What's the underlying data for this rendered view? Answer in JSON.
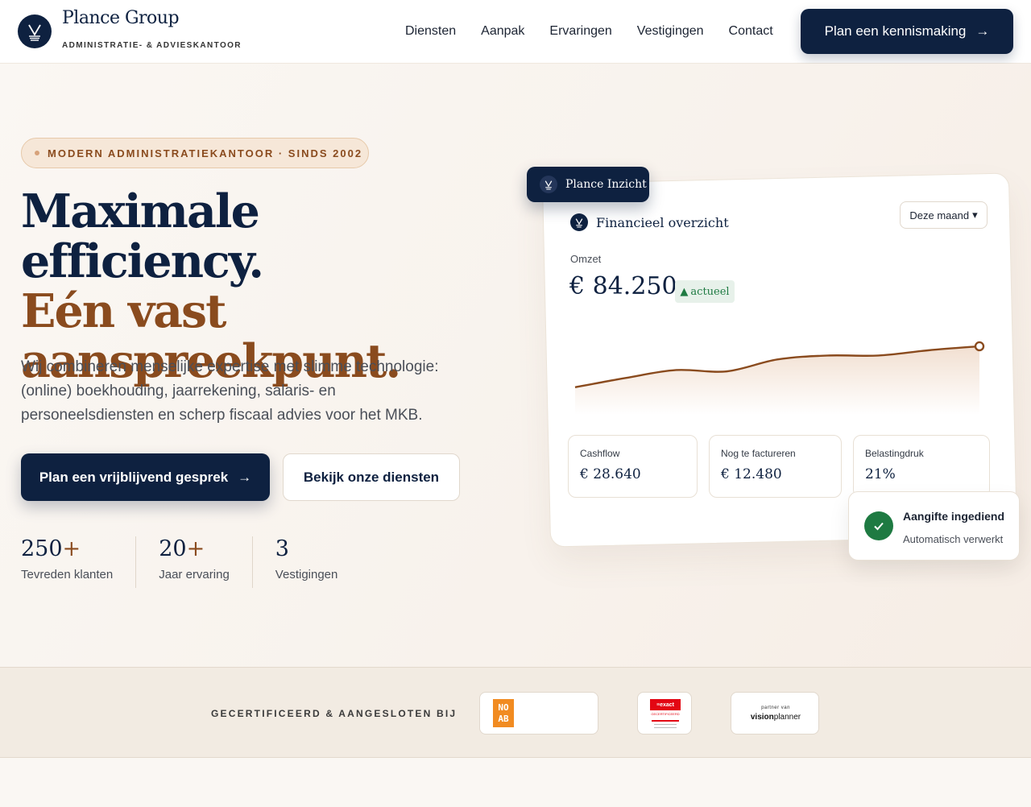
{
  "brand": {
    "name": "Plance Group",
    "subtitle": "ADMINISTRATIE- & ADVIESKANTOOR"
  },
  "nav": {
    "items": [
      "Diensten",
      "Aanpak",
      "Ervaringen",
      "Vestigingen",
      "Contact"
    ],
    "cta": "Plan een kennismaking",
    "cta_arrow": "→"
  },
  "hero": {
    "badge": "MODERN ADMINISTRATIEKANTOOR · SINDS 2002",
    "title_line1": "Maximale efficiency.",
    "title_line2": "Eén vast aanspreekpunt.",
    "lead": "Wij combineren menselijke expertise met slimme technologie: (online) boekhouding, jaarrekening, salaris- en personeelsdiensten en scherp fiscaal advies voor het MKB.",
    "primary_button": "Plan een vrijblijvend gesprek",
    "primary_arrow": "→",
    "secondary_button": "Bekijk onze diensten",
    "stats": [
      {
        "value": "250",
        "suffix": "+",
        "label": "Tevreden klanten"
      },
      {
        "value": "20",
        "suffix": "+",
        "label": "Jaar ervaring"
      },
      {
        "value": "3",
        "suffix": "",
        "label": "Vestigingen"
      }
    ]
  },
  "dashboard": {
    "tag": "Plance Inzicht",
    "title": "Financieel overzicht",
    "period": "Deze maand",
    "omzet_label": "Omzet",
    "omzet_value": "€ 84.250",
    "omzet_badge": "actueel",
    "kpis": [
      {
        "label": "Cashflow",
        "value": "€ 28.640"
      },
      {
        "label": "Nog te factureren",
        "value": "€ 12.480"
      },
      {
        "label": "Belastingdruk",
        "value": "21%"
      }
    ],
    "toast": {
      "title": "Aangifte ingediend",
      "subtitle": "Automatisch verwerkt"
    },
    "line_color": "#8a4b1e"
  },
  "chart_data": {
    "type": "area",
    "values": [
      10,
      24,
      36,
      34,
      52,
      58,
      58,
      66,
      72
    ],
    "ylim": [
      0,
      100
    ]
  },
  "certifications": {
    "label": "GECERTIFICEERD & AANGESLOTEN BIJ",
    "noab": {
      "line1": "NO",
      "line2": "AB"
    },
    "exact": {
      "brand": "≡exact",
      "badge": "GECERTIFICEERD"
    },
    "visionplanner": {
      "top": "partner van",
      "brand_bold": "vision",
      "brand_rest": "planner"
    }
  },
  "colors": {
    "navy": "#0e2140",
    "brown": "#8a4b1e",
    "green": "#1e7a42"
  }
}
